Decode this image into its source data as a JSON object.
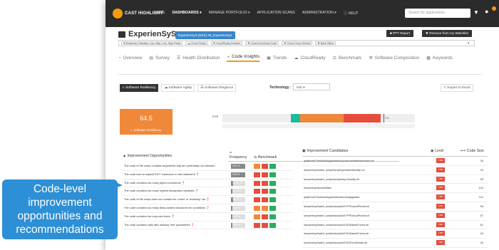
{
  "app": {
    "logo_text": "CAST HIGHLIGHT",
    "nav": [
      "HOME",
      "DASHBOARDS ▾",
      "MANAGE PORTFOLIO ▾",
      "APPLICATION SCANS",
      "ADMINISTRATION ▾",
      "ⓘ HELP"
    ],
    "search_placeholder": "Search for applications",
    "name": "ExperienSyS",
    "badge": "ExperienSyS (ESS) #8_ExperienSyS",
    "ppt_button": "PPT Report",
    "remove_button": "Remove from my Watchlist",
    "tags": [
      "⚑ Business-Criticality: Low, High, Low, High Relay",
      "☁ Cloud-Ready",
      "⚑ CloudReady-Enabled",
      "⚑ Cross-Functional Code",
      "⚑ Cross-Cloud Service",
      "⚑ Back Office"
    ]
  },
  "tabs": [
    {
      "icon": "◔",
      "label": "Overview"
    },
    {
      "icon": "▤",
      "label": "Survey"
    },
    {
      "icon": "☰",
      "label": "Health Distribution"
    },
    {
      "icon": "◒",
      "label": "Code Insights",
      "active": true
    },
    {
      "icon": "▣",
      "label": "Trends"
    },
    {
      "icon": "☁",
      "label": "CloudReady"
    },
    {
      "icon": "⚖",
      "label": "Benchmark"
    },
    {
      "icon": "⚒",
      "label": "Software Composition"
    },
    {
      "icon": "▦",
      "label": "Keywords"
    }
  ],
  "subtabs": [
    "◐ Software Resiliency",
    "☁ Software Agility",
    "☰ Software Elegance"
  ],
  "technology_label": "Technology :",
  "technology_value": "Ksh ▾",
  "export_label": "⇩ Export to Excel",
  "score": {
    "value": "64.5",
    "label": "◐ Software Resiliency"
  },
  "dist": {
    "label": "Ksh",
    "pct": "1%"
  },
  "left_table": {
    "header_col1": "▲ Improvement Opportunities",
    "header_col2": "Frequency",
    "header_col3": "Benchmark",
    "rows": [
      {
        "desc": "The code of the script contains arguments that are potentially not checked",
        "freq": "100 %",
        "fill": 1.0,
        "bench": [
          "#f0883a",
          "#e74c3c",
          "#27ae60"
        ]
      },
      {
        "desc": "The code has no explicit EXIT instruction in last statement ❓",
        "freq": "100 %",
        "fill": 1.0,
        "bench": [
          "#e74c3c",
          "#e74c3c",
          "#27ae60"
        ]
      },
      {
        "desc": "The code contains too many piped commands ❓",
        "freq": "16.25 %",
        "fill": 0.16,
        "bench": [
          "#e74c3c",
          "#e74c3c",
          "#27ae60"
        ]
      },
      {
        "desc": "The code contains too many implicit declaration variables ❓",
        "freq": "11.25 %",
        "fill": 0.11,
        "bench": [
          "#e74c3c",
          "#e74c3c",
          "#27ae60"
        ]
      },
      {
        "desc": "The code of the script does not contain the 'unset' or 'readonly' var ❓",
        "freq": "16.25 %",
        "fill": 0.16,
        "bench": [
          "#e74c3c",
          "#e74c3c",
          "#27ae60"
        ]
      },
      {
        "desc": "The code contains too many deep-nested structures for conditions ❓",
        "freq": "6.25 %",
        "fill": 0.06,
        "bench": [
          "#f0883a",
          "#f0883a",
          "#27ae60"
        ]
      },
      {
        "desc": "The code contains too long one-liners ❓",
        "freq": "3.85 %",
        "fill": 0.04,
        "bench": [
          "#f0883a",
          "#e74c3c",
          "#27ae60"
        ]
      },
      {
        "desc": "The code contains calls with missing 'rest' parameters ❓",
        "freq": "1.85 %",
        "fill": 0.02,
        "bench": [
          "#e74c3c",
          "#e74c3c",
          "#27ae60"
        ]
      }
    ]
  },
  "right_table": {
    "header_col1": "▣ Improvement Candidates",
    "header_col2": "Level",
    "header_col3": "⟷ Code Size",
    "rows": [
      {
        "path": "/platform/CmdAnd/application/xyz/arrowindex/services.sh",
        "level": "Low",
        "size": "34"
      },
      {
        "path": "/amperexp/batch_script/script/xyz/select/tooltip.sh",
        "level": "Low",
        "size": "34"
      },
      {
        "path": "/amperexp/batch_script/scripts/repo/tooltip.sh",
        "level": "Low",
        "size": "55"
      },
      {
        "path": "/amperexp/scripts/files",
        "level": "Low",
        "size": "124"
      },
      {
        "path": "/platform/CmdAnd/application/androidpgsales",
        "level": "Low",
        "size": "110"
      },
      {
        "path": "/amperexp/batch_scripts/scripts/XYPP/cloudPortal.sh",
        "level": "Low",
        "size": "98"
      },
      {
        "path": "/amperexp/batch_scripts/scripts/XYPP/cloudPortal.sh",
        "level": "Low",
        "size": "87"
      },
      {
        "path": "/amperexp/batch_scripts/scripts/XVD/NameForms.sh",
        "level": "Low",
        "size": "61"
      },
      {
        "path": "/amperexp/batch_scripts/scripts/XVD/NameForms.sh",
        "level": "Low",
        "size": "40"
      },
      {
        "path": "/amperexp/batch_scripts/scripts/XVD/FormDetail.sh",
        "level": "Low",
        "size": "40"
      }
    ]
  },
  "callout": "Code-level improvement opportunities and recommendations",
  "colors": {
    "accent": "#f39c12",
    "callout": "#2d8fd5",
    "score": "#f0883a",
    "low": "#e74c3c"
  }
}
